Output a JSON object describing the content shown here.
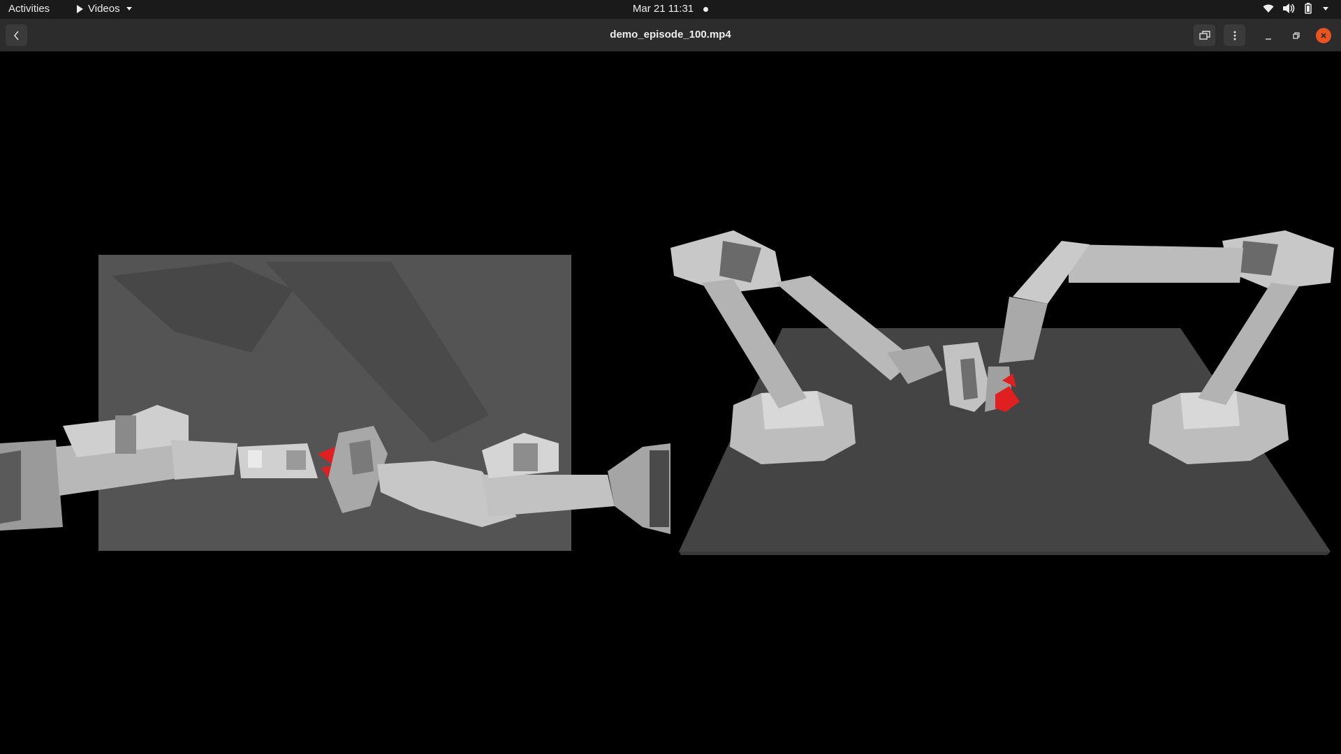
{
  "topbar": {
    "activities_label": "Activities",
    "app_name": "Videos",
    "clock": "Mar 21  11:31",
    "icons": [
      "wifi-icon",
      "volume-icon",
      "battery-icon",
      "system-menu-caret-icon"
    ]
  },
  "headerbar": {
    "title": "demo_episode_100.mp4",
    "buttons": [
      "back-button",
      "fullscreen-button",
      "more-options-button",
      "minimize-button",
      "maximize-button",
      "close-button"
    ]
  },
  "video": {
    "content": "Two simulated bimanual robot arm views",
    "colors": {
      "background": "#000000",
      "table": "#454545",
      "arm": "#b5b5b5",
      "object": "#e02020",
      "accent_close": "#e95420"
    }
  }
}
